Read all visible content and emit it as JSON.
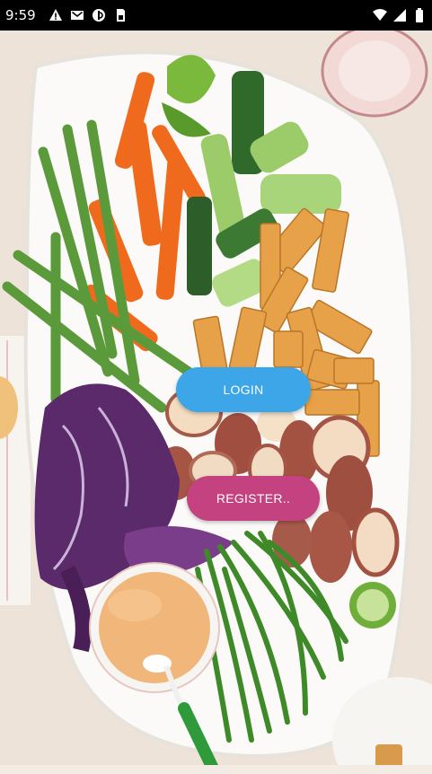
{
  "status_bar": {
    "time": "9:59",
    "left_icons": [
      "warning-icon",
      "gmail-icon",
      "cast-icon",
      "sim-card-icon"
    ],
    "right_icons": [
      "wifi-icon",
      "cellular-signal-icon",
      "battery-icon"
    ]
  },
  "background": {
    "description_icon": "vegetable-platter-image"
  },
  "buttons": {
    "login_label": "LOGIN",
    "register_label": "REGISTER..",
    "login_color": "#3da6e8",
    "register_color": "#c4427f"
  }
}
